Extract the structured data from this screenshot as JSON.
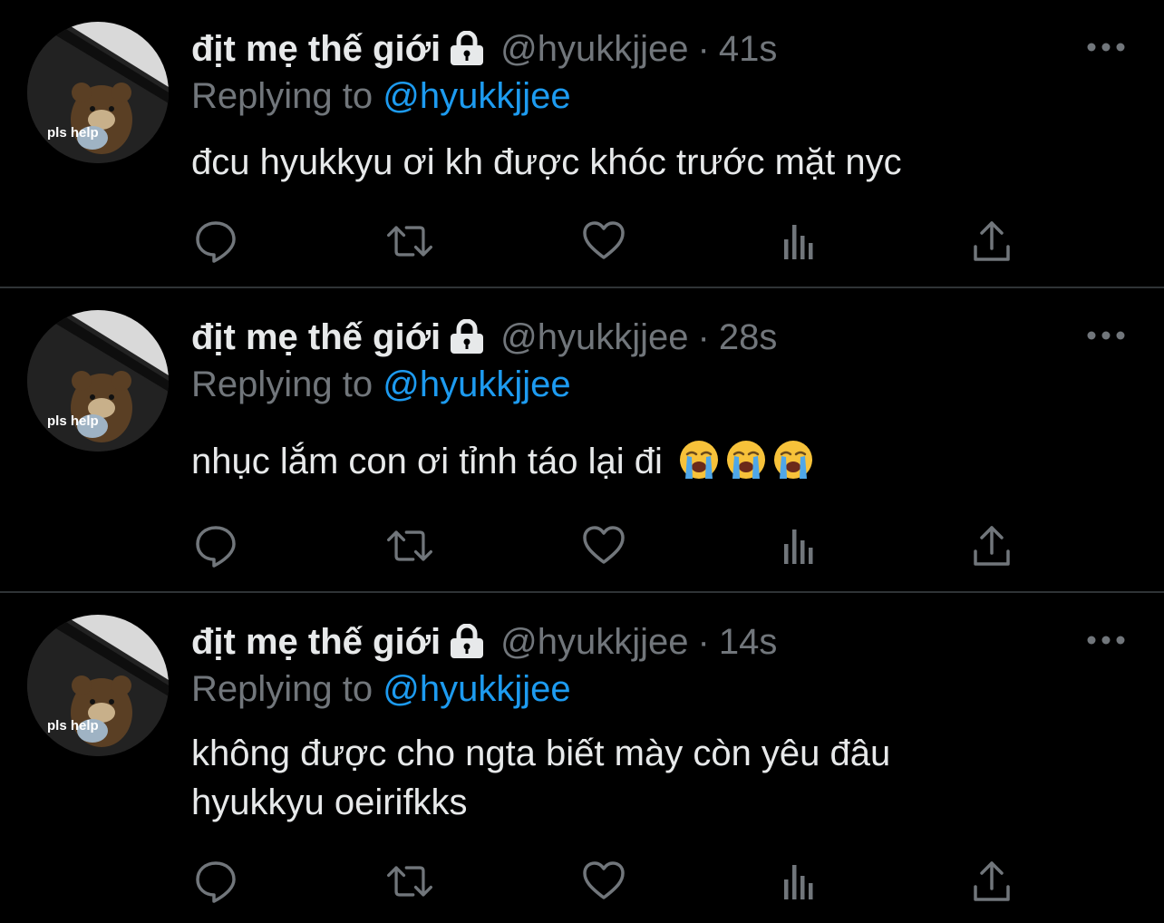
{
  "theme": {
    "background": "#000000",
    "text_primary": "#e7e9ea",
    "text_secondary": "#71767b",
    "link": "#1d9bf0",
    "divider": "#2f3336"
  },
  "icons": {
    "protected": "lock-icon",
    "more": "more-options-icon",
    "reply": "reply-icon",
    "retweet": "retweet-icon",
    "like": "like-icon",
    "analytics": "analytics-icon",
    "share": "share-icon",
    "emoji": "loudly-crying-face-emoji"
  },
  "tweets": [
    {
      "avatar_caption": "pls help",
      "display_name": "địt mẹ thế giới",
      "handle": "@hyukkjjee",
      "separator": "·",
      "time": "41s",
      "replying_prefix": "Replying to",
      "replying_to": "@hyukkjjee",
      "text": "đcu hyukkyu ơi kh được khóc trước mặt nyc",
      "emoji_count": 0
    },
    {
      "avatar_caption": "pls help",
      "display_name": "địt mẹ thế giới",
      "handle": "@hyukkjjee",
      "separator": "·",
      "time": "28s",
      "replying_prefix": "Replying to",
      "replying_to": "@hyukkjjee",
      "text": "nhục lắm con ơi tỉnh táo lại đi",
      "emoji_count": 3
    },
    {
      "avatar_caption": "pls help",
      "display_name": "địt mẹ thế giới",
      "handle": "@hyukkjjee",
      "separator": "·",
      "time": "14s",
      "replying_prefix": "Replying to",
      "replying_to": "@hyukkjjee",
      "text_line1": "không được cho ngta biết mày còn yêu đâu",
      "text_line2": "hyukkyu oeirifkks",
      "emoji_count": 0
    }
  ]
}
